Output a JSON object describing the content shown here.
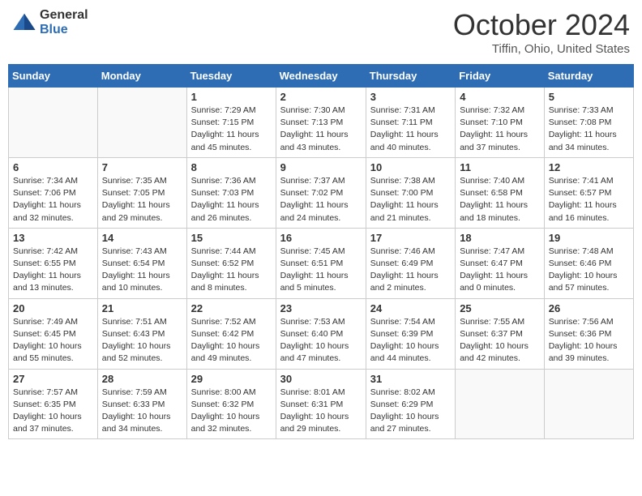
{
  "header": {
    "logo_general": "General",
    "logo_blue": "Blue",
    "title": "October 2024",
    "location": "Tiffin, Ohio, United States"
  },
  "days_of_week": [
    "Sunday",
    "Monday",
    "Tuesday",
    "Wednesday",
    "Thursday",
    "Friday",
    "Saturday"
  ],
  "weeks": [
    [
      {
        "day": "",
        "sunrise": "",
        "sunset": "",
        "daylight": ""
      },
      {
        "day": "",
        "sunrise": "",
        "sunset": "",
        "daylight": ""
      },
      {
        "day": "1",
        "sunrise": "Sunrise: 7:29 AM",
        "sunset": "Sunset: 7:15 PM",
        "daylight": "Daylight: 11 hours and 45 minutes."
      },
      {
        "day": "2",
        "sunrise": "Sunrise: 7:30 AM",
        "sunset": "Sunset: 7:13 PM",
        "daylight": "Daylight: 11 hours and 43 minutes."
      },
      {
        "day": "3",
        "sunrise": "Sunrise: 7:31 AM",
        "sunset": "Sunset: 7:11 PM",
        "daylight": "Daylight: 11 hours and 40 minutes."
      },
      {
        "day": "4",
        "sunrise": "Sunrise: 7:32 AM",
        "sunset": "Sunset: 7:10 PM",
        "daylight": "Daylight: 11 hours and 37 minutes."
      },
      {
        "day": "5",
        "sunrise": "Sunrise: 7:33 AM",
        "sunset": "Sunset: 7:08 PM",
        "daylight": "Daylight: 11 hours and 34 minutes."
      }
    ],
    [
      {
        "day": "6",
        "sunrise": "Sunrise: 7:34 AM",
        "sunset": "Sunset: 7:06 PM",
        "daylight": "Daylight: 11 hours and 32 minutes."
      },
      {
        "day": "7",
        "sunrise": "Sunrise: 7:35 AM",
        "sunset": "Sunset: 7:05 PM",
        "daylight": "Daylight: 11 hours and 29 minutes."
      },
      {
        "day": "8",
        "sunrise": "Sunrise: 7:36 AM",
        "sunset": "Sunset: 7:03 PM",
        "daylight": "Daylight: 11 hours and 26 minutes."
      },
      {
        "day": "9",
        "sunrise": "Sunrise: 7:37 AM",
        "sunset": "Sunset: 7:02 PM",
        "daylight": "Daylight: 11 hours and 24 minutes."
      },
      {
        "day": "10",
        "sunrise": "Sunrise: 7:38 AM",
        "sunset": "Sunset: 7:00 PM",
        "daylight": "Daylight: 11 hours and 21 minutes."
      },
      {
        "day": "11",
        "sunrise": "Sunrise: 7:40 AM",
        "sunset": "Sunset: 6:58 PM",
        "daylight": "Daylight: 11 hours and 18 minutes."
      },
      {
        "day": "12",
        "sunrise": "Sunrise: 7:41 AM",
        "sunset": "Sunset: 6:57 PM",
        "daylight": "Daylight: 11 hours and 16 minutes."
      }
    ],
    [
      {
        "day": "13",
        "sunrise": "Sunrise: 7:42 AM",
        "sunset": "Sunset: 6:55 PM",
        "daylight": "Daylight: 11 hours and 13 minutes."
      },
      {
        "day": "14",
        "sunrise": "Sunrise: 7:43 AM",
        "sunset": "Sunset: 6:54 PM",
        "daylight": "Daylight: 11 hours and 10 minutes."
      },
      {
        "day": "15",
        "sunrise": "Sunrise: 7:44 AM",
        "sunset": "Sunset: 6:52 PM",
        "daylight": "Daylight: 11 hours and 8 minutes."
      },
      {
        "day": "16",
        "sunrise": "Sunrise: 7:45 AM",
        "sunset": "Sunset: 6:51 PM",
        "daylight": "Daylight: 11 hours and 5 minutes."
      },
      {
        "day": "17",
        "sunrise": "Sunrise: 7:46 AM",
        "sunset": "Sunset: 6:49 PM",
        "daylight": "Daylight: 11 hours and 2 minutes."
      },
      {
        "day": "18",
        "sunrise": "Sunrise: 7:47 AM",
        "sunset": "Sunset: 6:47 PM",
        "daylight": "Daylight: 11 hours and 0 minutes."
      },
      {
        "day": "19",
        "sunrise": "Sunrise: 7:48 AM",
        "sunset": "Sunset: 6:46 PM",
        "daylight": "Daylight: 10 hours and 57 minutes."
      }
    ],
    [
      {
        "day": "20",
        "sunrise": "Sunrise: 7:49 AM",
        "sunset": "Sunset: 6:45 PM",
        "daylight": "Daylight: 10 hours and 55 minutes."
      },
      {
        "day": "21",
        "sunrise": "Sunrise: 7:51 AM",
        "sunset": "Sunset: 6:43 PM",
        "daylight": "Daylight: 10 hours and 52 minutes."
      },
      {
        "day": "22",
        "sunrise": "Sunrise: 7:52 AM",
        "sunset": "Sunset: 6:42 PM",
        "daylight": "Daylight: 10 hours and 49 minutes."
      },
      {
        "day": "23",
        "sunrise": "Sunrise: 7:53 AM",
        "sunset": "Sunset: 6:40 PM",
        "daylight": "Daylight: 10 hours and 47 minutes."
      },
      {
        "day": "24",
        "sunrise": "Sunrise: 7:54 AM",
        "sunset": "Sunset: 6:39 PM",
        "daylight": "Daylight: 10 hours and 44 minutes."
      },
      {
        "day": "25",
        "sunrise": "Sunrise: 7:55 AM",
        "sunset": "Sunset: 6:37 PM",
        "daylight": "Daylight: 10 hours and 42 minutes."
      },
      {
        "day": "26",
        "sunrise": "Sunrise: 7:56 AM",
        "sunset": "Sunset: 6:36 PM",
        "daylight": "Daylight: 10 hours and 39 minutes."
      }
    ],
    [
      {
        "day": "27",
        "sunrise": "Sunrise: 7:57 AM",
        "sunset": "Sunset: 6:35 PM",
        "daylight": "Daylight: 10 hours and 37 minutes."
      },
      {
        "day": "28",
        "sunrise": "Sunrise: 7:59 AM",
        "sunset": "Sunset: 6:33 PM",
        "daylight": "Daylight: 10 hours and 34 minutes."
      },
      {
        "day": "29",
        "sunrise": "Sunrise: 8:00 AM",
        "sunset": "Sunset: 6:32 PM",
        "daylight": "Daylight: 10 hours and 32 minutes."
      },
      {
        "day": "30",
        "sunrise": "Sunrise: 8:01 AM",
        "sunset": "Sunset: 6:31 PM",
        "daylight": "Daylight: 10 hours and 29 minutes."
      },
      {
        "day": "31",
        "sunrise": "Sunrise: 8:02 AM",
        "sunset": "Sunset: 6:29 PM",
        "daylight": "Daylight: 10 hours and 27 minutes."
      },
      {
        "day": "",
        "sunrise": "",
        "sunset": "",
        "daylight": ""
      },
      {
        "day": "",
        "sunrise": "",
        "sunset": "",
        "daylight": ""
      }
    ]
  ]
}
